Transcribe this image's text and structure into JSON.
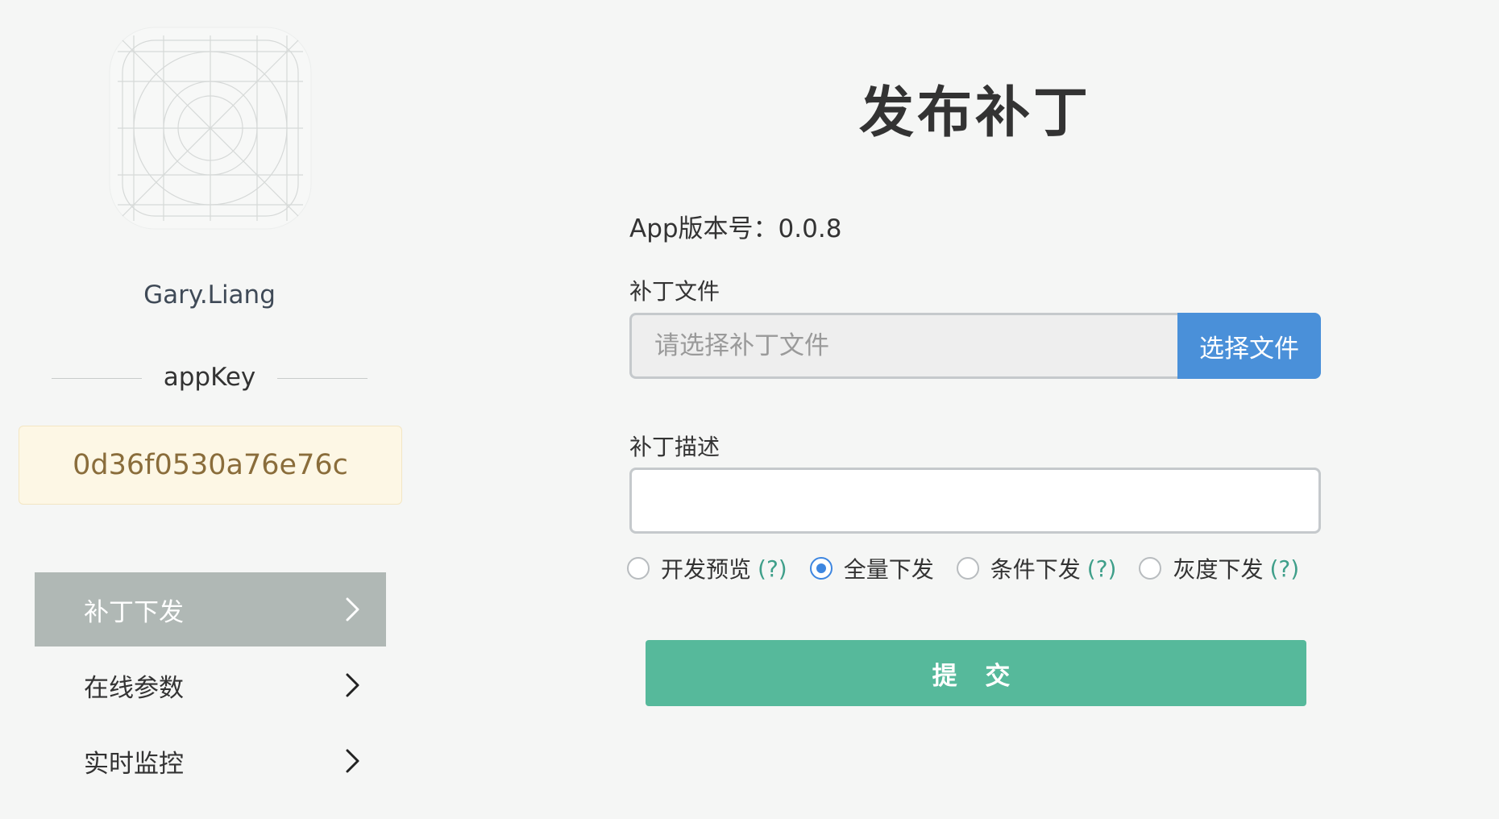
{
  "sidebar": {
    "username": "Gary.Liang",
    "appkey_label": "appKey",
    "appkey_value": "0d36f0530a76e76c",
    "nav": [
      {
        "label": "补丁下发",
        "icon": "chevron-right-icon",
        "active": true
      },
      {
        "label": "在线参数",
        "icon": "chevron-right-icon",
        "active": false
      },
      {
        "label": "实时监控",
        "icon": "chevron-right-icon",
        "active": false
      }
    ]
  },
  "main": {
    "title": "发布补丁",
    "version_line": "App版本号：0.0.8",
    "patch_file": {
      "label": "补丁文件",
      "placeholder": "请选择补丁文件",
      "button_label": "选择文件"
    },
    "patch_desc": {
      "label": "补丁描述",
      "value": ""
    },
    "release_modes": [
      {
        "label": "开发预览",
        "help": "(?)",
        "checked": false
      },
      {
        "label": "全量下发",
        "help": "",
        "checked": true
      },
      {
        "label": "条件下发",
        "help": "(?)",
        "checked": false
      },
      {
        "label": "灰度下发",
        "help": "(?)",
        "checked": false
      }
    ],
    "submit_label": "提 交"
  },
  "colors": {
    "background": "#f5f6f5",
    "nav_active": "#b0b8b5",
    "primary_blue": "#4a90d9",
    "submit_green": "#56b99b",
    "help_link": "#3f9f8a",
    "appkey_bg": "#fdf7e5",
    "appkey_text": "#8a6d3b"
  }
}
